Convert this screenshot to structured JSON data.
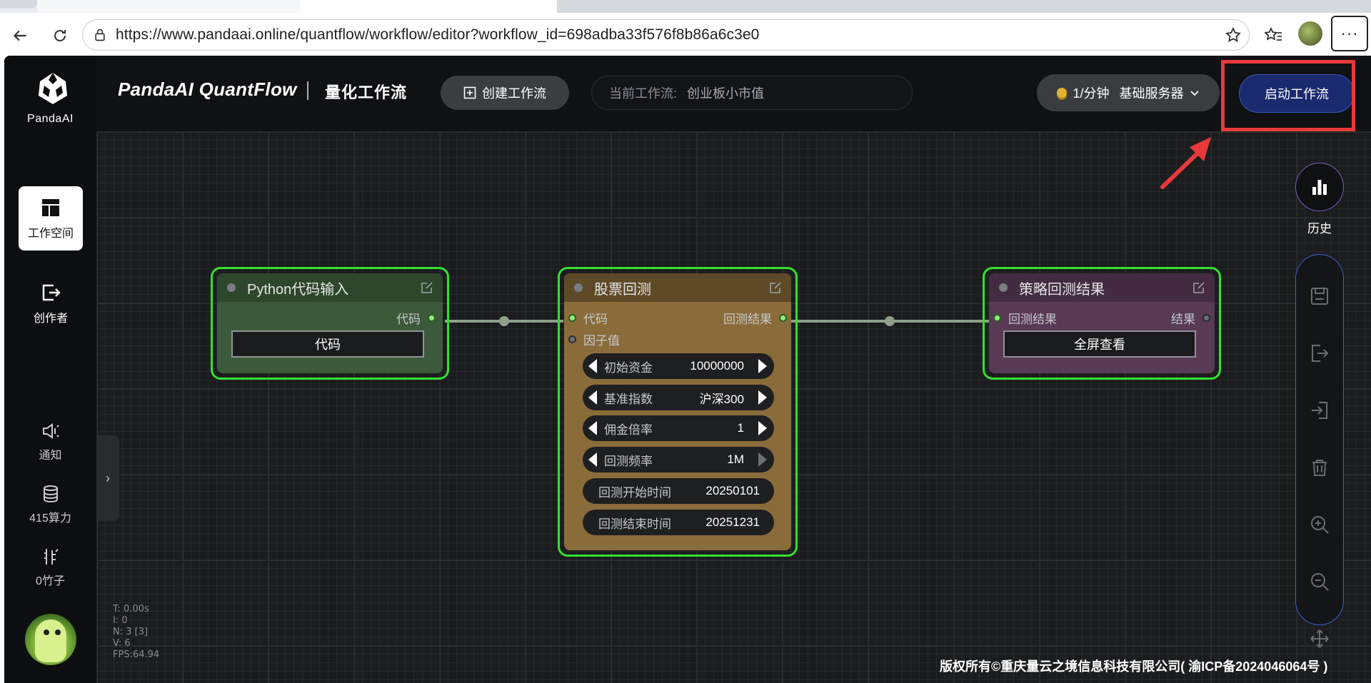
{
  "browser": {
    "url": "https://www.pandaai.online/quantflow/workflow/editor?workflow_id=698adba33f576f8b86a6c3e0",
    "more_label": "···"
  },
  "sidebar": {
    "logo_text": "PandaAI",
    "items": [
      {
        "label": "工作空间",
        "icon": "dashboard-icon",
        "active": true
      },
      {
        "label": "创作者",
        "icon": "export-icon",
        "active": false
      }
    ],
    "notify_label": "通知",
    "compute_label": "415算力",
    "bamboo_label": "0竹子"
  },
  "header": {
    "brand": "PandaAI QuantFlow",
    "subtitle": "量化工作流",
    "create_label": "创建工作流",
    "current_label": "当前工作流:",
    "current_value": "创业板小市值",
    "plan_rate": "1/分钟",
    "plan_server": "基础服务器",
    "start_label": "启动工作流"
  },
  "nodes": {
    "python": {
      "title": "Python代码输入",
      "out_port": "代码",
      "button": "代码"
    },
    "backtest": {
      "title": "股票回测",
      "in_ports": [
        "代码",
        "因子值"
      ],
      "out_port": "回测结果",
      "params": [
        {
          "label": "初始资金",
          "value": "10000000"
        },
        {
          "label": "基准指数",
          "value": "沪深300"
        },
        {
          "label": "佣金倍率",
          "value": "1"
        },
        {
          "label": "回测频率",
          "value": "1M"
        },
        {
          "label": "回测开始时间",
          "value": "20250101"
        },
        {
          "label": "回测结束时间",
          "value": "20251231"
        }
      ]
    },
    "result": {
      "title": "策略回测结果",
      "in_port": "回测结果",
      "out_port": "结果",
      "button": "全屏查看"
    }
  },
  "right_panel": {
    "history_label": "历史"
  },
  "stats": [
    "T: 0.00s",
    "I: 0",
    "N: 3 [3]",
    "V: 6",
    "FPS:64.94"
  ],
  "footer": {
    "copyright": "版权所有©重庆量云之境信息科技有限公司( 渝ICP备2024046064号 )"
  },
  "colors": {
    "accent_start": "#1a2a6e",
    "node_border": "#33e02f",
    "annotation": "#e8393a"
  }
}
